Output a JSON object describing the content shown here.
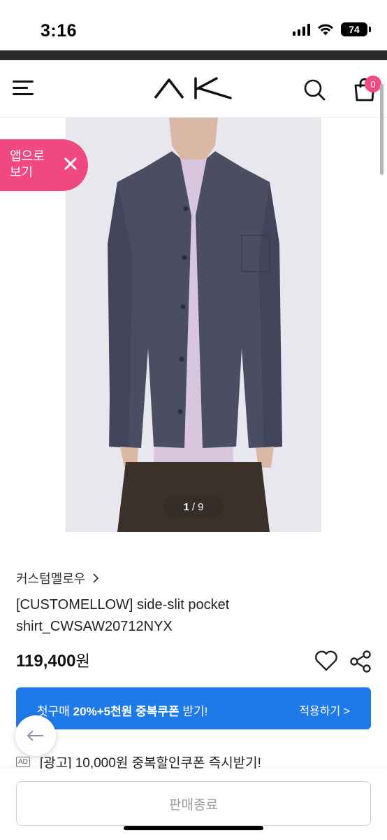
{
  "status_bar": {
    "time": "3:16",
    "battery": "74",
    "icons": [
      "cellular-signal-icon",
      "wifi-icon",
      "battery-icon"
    ]
  },
  "header": {
    "logo_text": "AK",
    "cart_count": "0",
    "icons": [
      "hamburger-menu-icon",
      "search-icon",
      "shopping-bag-icon"
    ]
  },
  "app_banner": {
    "label": "앱으로 보기",
    "close_icon": "close-icon",
    "color": "#f0487f"
  },
  "gallery": {
    "current": "1",
    "separator": "/",
    "total": "9"
  },
  "product": {
    "brand": "커스텀멜로우",
    "name": "[CUSTOMELLOW] side-slit pocket shirt_CWSAW20712NYX",
    "price": "119,400",
    "price_unit": "원"
  },
  "coupon": {
    "text_prefix": "첫구매 ",
    "text_bold": "20%+5천원 중복쿠폰",
    "text_suffix": " 받기!",
    "apply_label": "적용하기 >",
    "color": "#1e7ae8"
  },
  "ad": {
    "tag": "AD",
    "text": "[광고] 10,000원 중복할인쿠폰 즉시받기!"
  },
  "bottom": {
    "sold_out_label": "판매종료"
  }
}
